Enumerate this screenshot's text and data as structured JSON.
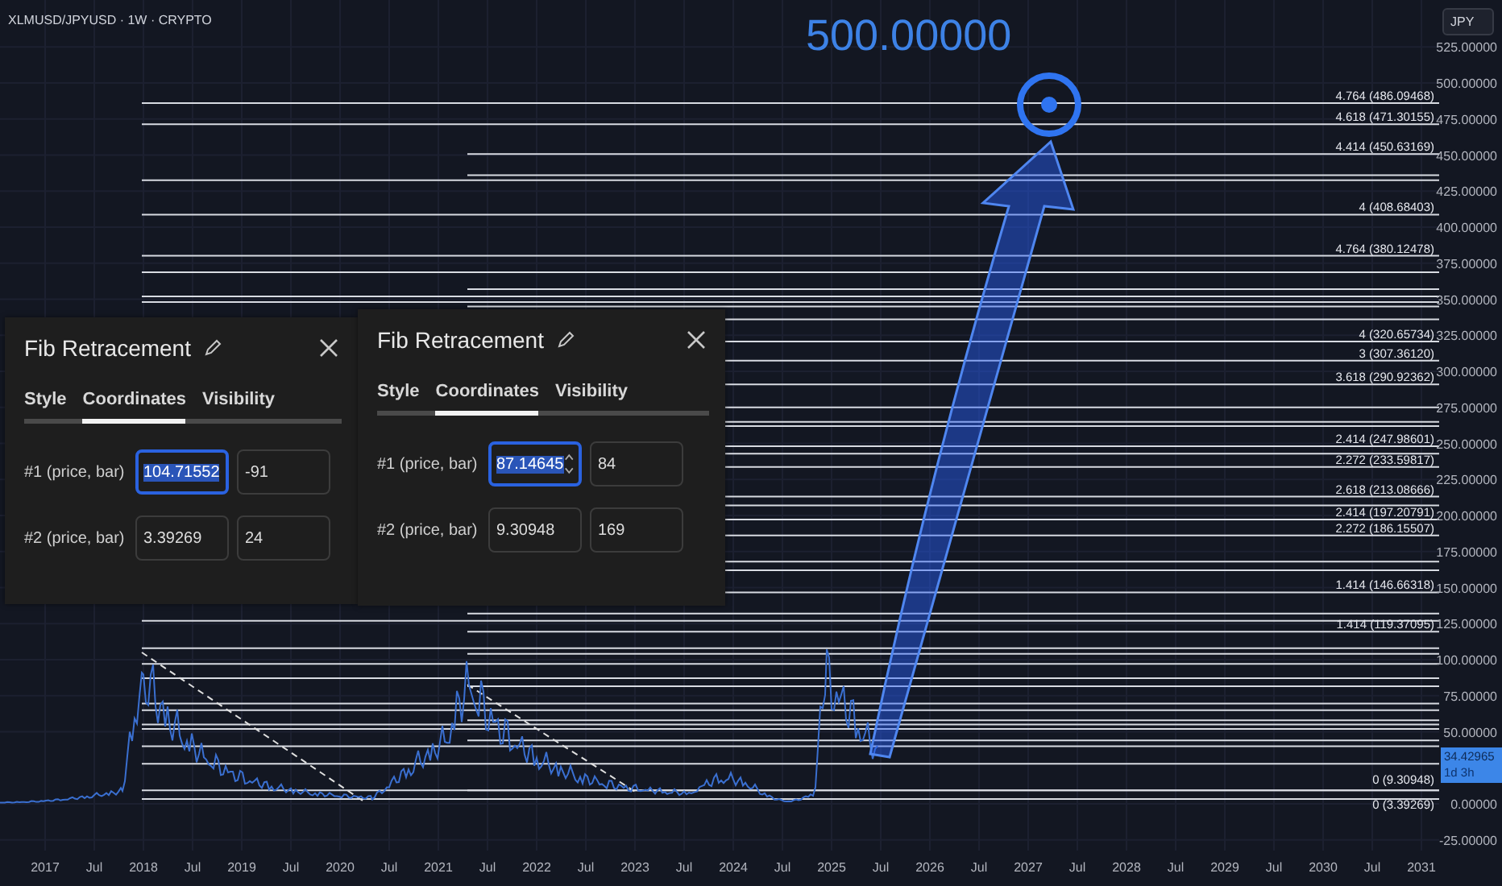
{
  "chart": {
    "symbol": "XLMUSD/JPYUSD · 1W · CRYPTO",
    "currency_button": "JPY",
    "target_label": "500.00000",
    "price_axis": [
      "525.00000",
      "500.00000",
      "475.00000",
      "450.00000",
      "425.00000",
      "400.00000",
      "375.00000",
      "350.00000",
      "325.00000",
      "300.00000",
      "275.00000",
      "250.00000",
      "225.00000",
      "200.00000",
      "175.00000",
      "150.00000",
      "125.00000",
      "100.00000",
      "75.00000",
      "50.00000",
      "0.00000",
      "-25.00000"
    ],
    "time_axis": [
      "2017",
      "Jul",
      "2018",
      "Jul",
      "2019",
      "Jul",
      "2020",
      "Jul",
      "2021",
      "Jul",
      "2022",
      "Jul",
      "2023",
      "Jul",
      "2024",
      "Jul",
      "2025",
      "Jul",
      "2026",
      "Jul",
      "2027",
      "Jul",
      "2028",
      "Jul",
      "2029",
      "Jul",
      "2030",
      "Jul",
      "2031"
    ],
    "last_price": {
      "price": "34.42965",
      "countdown": "1d 3h"
    },
    "fib_labels": [
      "4.764 (486.09468)",
      "4.618 (471.30155)",
      "4.414 (450.63169)",
      "4 (408.68403)",
      "4.764 (380.12478)",
      "4 (320.65734)",
      "3 (307.36120)",
      "3.618 (290.92362)",
      "2.414 (247.98601)",
      "2.272 (233.59817)",
      "2.618 (213.08666)",
      "2.414 (197.20791)",
      "2.272 (186.15507)",
      "1.414 (146.66318)",
      "1.414 (119.37095)",
      "0 (9.30948)",
      "0 (3.39269)"
    ]
  },
  "dialogs": [
    {
      "title": "Fib Retracement",
      "tabs": [
        {
          "label": "Style",
          "selected": false
        },
        {
          "label": "Coordinates",
          "selected": true
        },
        {
          "label": "Visibility",
          "selected": false
        }
      ],
      "rows": [
        {
          "label": "#1 (price, bar)",
          "price": "104.71552",
          "bar": "-91",
          "focused": true
        },
        {
          "label": "#2 (price, bar)",
          "price": "3.39269",
          "bar": "24",
          "focused": false
        }
      ]
    },
    {
      "title": "Fib Retracement",
      "tabs": [
        {
          "label": "Style",
          "selected": false
        },
        {
          "label": "Coordinates",
          "selected": true
        },
        {
          "label": "Visibility",
          "selected": false
        }
      ],
      "rows": [
        {
          "label": "#1 (price, bar)",
          "price": "87.14645",
          "bar": "84",
          "focused": true
        },
        {
          "label": "#2 (price, bar)",
          "price": "9.30948",
          "bar": "169",
          "focused": false
        }
      ]
    }
  ]
}
